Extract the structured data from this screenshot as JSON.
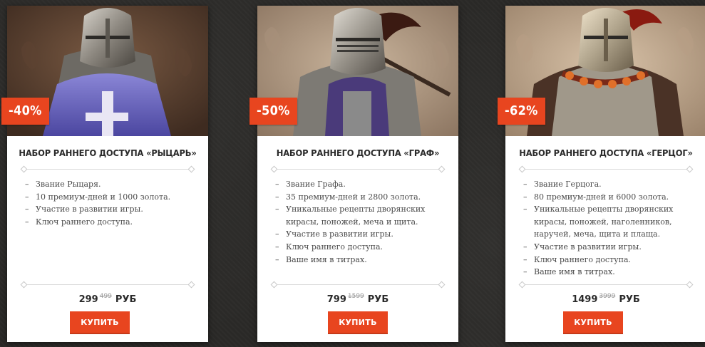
{
  "currency": "РУБ",
  "cards": [
    {
      "discount": "-40%",
      "title": "НАБОР РАННЕГО ДОСТУПА «РЫЦАРЬ»",
      "features": [
        "Звание Рыцаря.",
        "10 премиум-дней и 1000 золота.",
        "Участие в развитии игры.",
        "Ключ раннего доступа."
      ],
      "price": "299",
      "old_price": "499",
      "buy_label": "КУПИТЬ"
    },
    {
      "discount": "-50%",
      "title": "НАБОР РАННЕГО ДОСТУПА «ГРАФ»",
      "features": [
        "Звание Графа.",
        "35 премиум-дней и 2800 золота.",
        "Уникальные рецепты дворянских кирасы, поножей, меча и щита.",
        "Участие в развитии игры.",
        "Ключ раннего доступа.",
        "Ваше имя в титрах."
      ],
      "price": "799",
      "old_price": "1599",
      "buy_label": "КУПИТЬ"
    },
    {
      "discount": "-62%",
      "title": "НАБОР РАННЕГО ДОСТУПА «ГЕРЦОГ»",
      "features": [
        "Звание Герцога.",
        "80 премиум-дней и 6000 золота.",
        "Уникальные рецепты дворянских кирасы, поножей, наголенников, наручей, меча, щита и плаща.",
        "Участие в развитии игры.",
        "Ключ раннего доступа.",
        "Ваше имя в титрах."
      ],
      "price": "1499",
      "old_price": "3999",
      "buy_label": "КУПИТЬ"
    }
  ],
  "colors": {
    "accent": "#e8451f",
    "background": "#2b2a28",
    "card": "#ffffff"
  }
}
